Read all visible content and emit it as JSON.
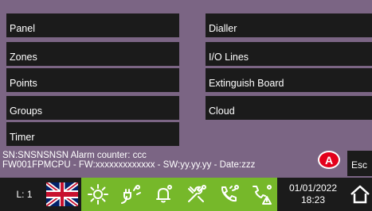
{
  "menu": {
    "left": [
      "Panel",
      "Zones",
      "Points",
      "Groups",
      "Timer"
    ],
    "right": [
      "Dialler",
      "I/O Lines",
      "Extinguish Board",
      "Cloud"
    ]
  },
  "info": {
    "line1": "SN:SNSNSNSN    Alarm counter: ccc",
    "line2": "FW001FPMCPU - FW:xxxxxxxxxxxxx - SW:yy.yy.yy - Date:zzz"
  },
  "alert_badge": "A",
  "esc_label": "Esc",
  "status": {
    "level": "L: 1",
    "flag": "uk-flag",
    "icons": [
      "sun-icon",
      "power-plug-icon",
      "bell-icon",
      "wrench-icon",
      "phone-fault-icon",
      "phone-alert-icon"
    ],
    "date": "01/01/2022",
    "time": "18:23",
    "home_icon": "home-icon"
  },
  "colors": {
    "background": "#7b6584",
    "button": "#1b1b1b",
    "status_strip": "#76b82a",
    "alert": "#e3001b",
    "text": "#ffffff"
  }
}
